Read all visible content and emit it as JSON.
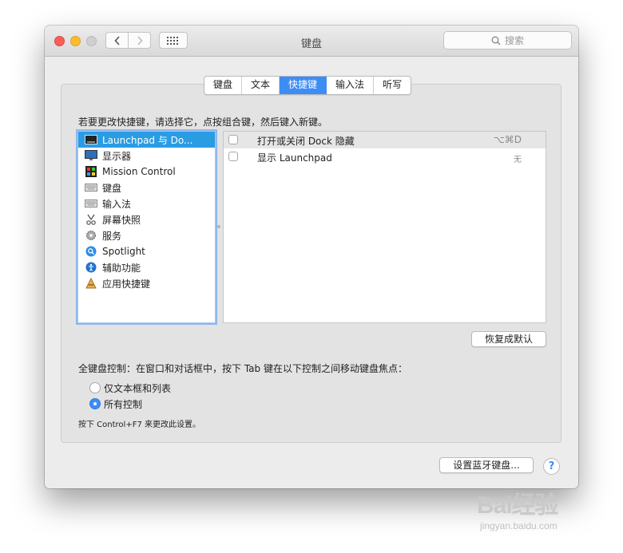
{
  "window": {
    "title": "键盘",
    "search_placeholder": "搜索"
  },
  "tabs": [
    {
      "label": "键盘",
      "active": false
    },
    {
      "label": "文本",
      "active": false
    },
    {
      "label": "快捷键",
      "active": true
    },
    {
      "label": "输入法",
      "active": false
    },
    {
      "label": "听写",
      "active": false
    }
  ],
  "instruction": "若要更改快捷键，请选择它，点按组合键，然后键入新键。",
  "categories": [
    {
      "label": "Launchpad 与 Do...",
      "icon": "launchpad-icon",
      "selected": true
    },
    {
      "label": "显示器",
      "icon": "display-icon",
      "selected": false
    },
    {
      "label": "Mission Control",
      "icon": "mission-control-icon",
      "selected": false
    },
    {
      "label": "键盘",
      "icon": "keyboard-icon",
      "selected": false
    },
    {
      "label": "输入法",
      "icon": "input-source-icon",
      "selected": false
    },
    {
      "label": "屏幕快照",
      "icon": "screenshot-icon",
      "selected": false
    },
    {
      "label": "服务",
      "icon": "services-gear-icon",
      "selected": false
    },
    {
      "label": "Spotlight",
      "icon": "spotlight-icon",
      "selected": false
    },
    {
      "label": "辅助功能",
      "icon": "accessibility-icon",
      "selected": false
    },
    {
      "label": "应用快捷键",
      "icon": "app-shortcuts-icon",
      "selected": false
    }
  ],
  "shortcuts": [
    {
      "label": "打开或关闭 Dock 隐藏",
      "key": "⌥⌘D",
      "checked": false
    },
    {
      "label": "显示 Launchpad",
      "key": "无",
      "checked": false
    }
  ],
  "restore_defaults": "恢复成默认",
  "full_keyboard_control": "全键盘控制：在窗口和对话框中，按下 Tab 键在以下控制之间移动键盘焦点：",
  "radio_options": [
    {
      "label": "仅文本框和列表",
      "selected": false
    },
    {
      "label": "所有控制",
      "selected": true
    }
  ],
  "hint": "按下 Control+F7 来更改此设置。",
  "bluetooth_button": "设置蓝牙键盘...",
  "help_button": "?",
  "watermark": {
    "line1": "Bai经验",
    "line2": "jingyan.baidu.com"
  },
  "colors": {
    "accent": "#3d8df6",
    "selection": "#2a9ce3"
  }
}
